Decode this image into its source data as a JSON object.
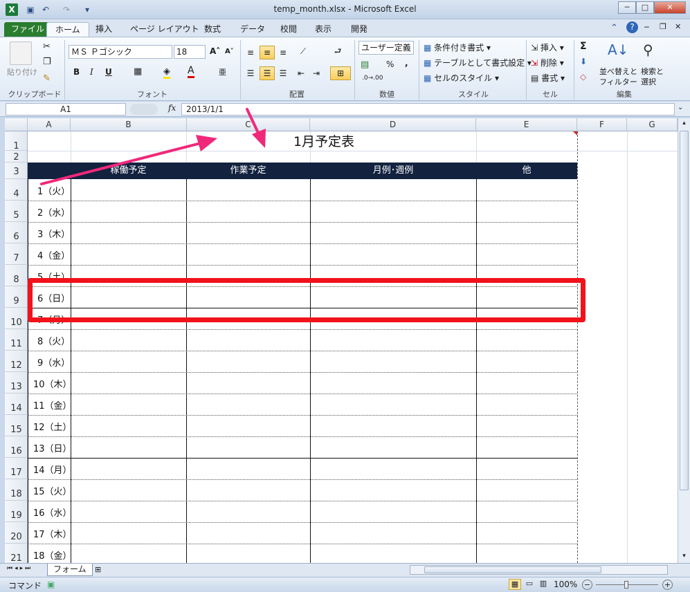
{
  "window": {
    "title": "temp_month.xlsx - Microsoft Excel",
    "app_icon": "X",
    "controls": [
      "─",
      "□",
      "✕"
    ]
  },
  "ribbon_tabs": [
    "ファイル",
    "ホーム",
    "挿入",
    "ページ レイアウト",
    "数式",
    "データ",
    "校閲",
    "表示",
    "開発"
  ],
  "ribbon": {
    "clipboard": {
      "paste": "貼り付け",
      "label": "クリップボード"
    },
    "font": {
      "name": "ＭＳ Ｐゴシック",
      "size": "18",
      "bold": "B",
      "italic": "I",
      "underline": "U",
      "label": "フォント"
    },
    "alignment": {
      "label": "配置"
    },
    "number": {
      "format": "ユーザー定義",
      "percent": "%",
      "comma": ",",
      "label": "数値"
    },
    "styles": {
      "conditional": "条件付き書式",
      "table": "テーブルとして書式設定",
      "cell": "セルのスタイル",
      "label": "スタイル"
    },
    "cells": {
      "insert": "挿入",
      "delete": "削除",
      "format": "書式",
      "label": "セル"
    },
    "editing": {
      "sum": "Σ",
      "sort1": "並べ替えと",
      "sort2": "フィルター",
      "find1": "検索と",
      "find2": "選択",
      "label": "編集"
    }
  },
  "formula_bar": {
    "name_box": "A1",
    "fx": "fx",
    "value": "2013/1/1"
  },
  "columns": [
    "A",
    "B",
    "C",
    "D",
    "E",
    "F",
    "G"
  ],
  "rows": [
    "1",
    "2",
    "3",
    "4",
    "5",
    "6",
    "7",
    "8",
    "9",
    "10",
    "11",
    "12",
    "13",
    "14",
    "15",
    "16",
    "17",
    "18",
    "19",
    "20",
    "21"
  ],
  "sheet_title": "1月予定表",
  "table_headers": [
    "稼働予定",
    "作業予定",
    "月例･週例",
    "他"
  ],
  "days": [
    "1（火）",
    "2（水）",
    "3（木）",
    "4（金）",
    "5（土）",
    "6（日）",
    "7（月）",
    "8（火）",
    "9（水）",
    "10（木）",
    "11（金）",
    "12（土）",
    "13（日）",
    "14（月）",
    "15（火）",
    "16（水）",
    "17（木）",
    "18（金）"
  ],
  "sheet_tabs": [
    "フォーム"
  ],
  "status": {
    "mode": "コマンド",
    "zoom": "100%"
  },
  "colors": {
    "header_band": "#12223f",
    "annotation": "#f0287a",
    "highlight": "#f1121b",
    "file_tab": "#2a7d2e"
  }
}
